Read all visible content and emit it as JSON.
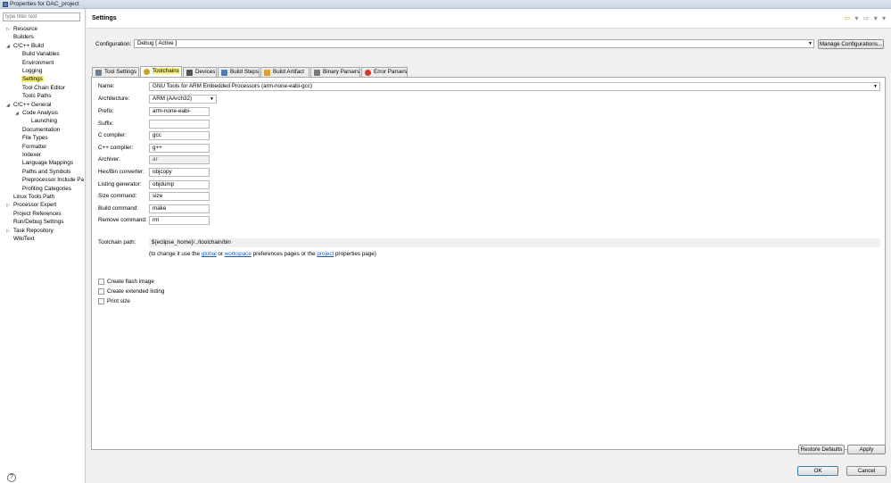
{
  "window": {
    "title": "Properties for DAC_project"
  },
  "left": {
    "filter_placeholder": "type filter text",
    "tree": [
      {
        "label": "Resource",
        "depth": 0,
        "twisty": "▷",
        "selected": false
      },
      {
        "label": "Builders",
        "depth": 0,
        "twisty": "",
        "selected": false
      },
      {
        "label": "C/C++ Build",
        "depth": 0,
        "twisty": "◢",
        "selected": false
      },
      {
        "label": "Build Variables",
        "depth": 1,
        "twisty": "",
        "selected": false
      },
      {
        "label": "Environment",
        "depth": 1,
        "twisty": "",
        "selected": false
      },
      {
        "label": "Logging",
        "depth": 1,
        "twisty": "",
        "selected": false
      },
      {
        "label": "Settings",
        "depth": 1,
        "twisty": "",
        "selected": true
      },
      {
        "label": "Tool Chain Editor",
        "depth": 1,
        "twisty": "",
        "selected": false
      },
      {
        "label": "Tools Paths",
        "depth": 1,
        "twisty": "",
        "selected": false
      },
      {
        "label": "C/C++ General",
        "depth": 0,
        "twisty": "◢",
        "selected": false
      },
      {
        "label": "Code Analysis",
        "depth": 1,
        "twisty": "◢",
        "selected": false
      },
      {
        "label": "Launching",
        "depth": 2,
        "twisty": "",
        "selected": false
      },
      {
        "label": "Documentation",
        "depth": 1,
        "twisty": "",
        "selected": false
      },
      {
        "label": "File Types",
        "depth": 1,
        "twisty": "",
        "selected": false
      },
      {
        "label": "Formatter",
        "depth": 1,
        "twisty": "",
        "selected": false
      },
      {
        "label": "Indexer",
        "depth": 1,
        "twisty": "",
        "selected": false
      },
      {
        "label": "Language Mappings",
        "depth": 1,
        "twisty": "",
        "selected": false
      },
      {
        "label": "Paths and Symbols",
        "depth": 1,
        "twisty": "",
        "selected": false
      },
      {
        "label": "Preprocessor Include Pa",
        "depth": 1,
        "twisty": "",
        "selected": false
      },
      {
        "label": "Profiling Categories",
        "depth": 1,
        "twisty": "",
        "selected": false
      },
      {
        "label": "Linux Tools Path",
        "depth": 0,
        "twisty": "",
        "selected": false
      },
      {
        "label": "Processor Expert",
        "depth": 0,
        "twisty": "▷",
        "selected": false
      },
      {
        "label": "Project References",
        "depth": 0,
        "twisty": "",
        "selected": false
      },
      {
        "label": "Run/Debug Settings",
        "depth": 0,
        "twisty": "",
        "selected": false
      },
      {
        "label": "Task Repository",
        "depth": 0,
        "twisty": "▷",
        "selected": false
      },
      {
        "label": "WikiText",
        "depth": 0,
        "twisty": "",
        "selected": false
      }
    ],
    "help": "?"
  },
  "header": {
    "title": "Settings",
    "nav_back": "⇦",
    "nav_back_menu": "▾",
    "nav_forward": "⇨",
    "nav_forward_menu": "▾",
    "nav_menu": "▾"
  },
  "configuration": {
    "label": "Configuration:",
    "value": "Debug  [ Active ]",
    "manage_label": "Manage Configurations..."
  },
  "tabs": [
    {
      "label": "Tool Settings",
      "icon": "tool-settings-icon",
      "color": "#6a7f95",
      "active": false
    },
    {
      "label": "Toolchains",
      "icon": "toolchain-icon",
      "color": "#c8a31a",
      "active": true
    },
    {
      "label": "Devices",
      "icon": "device-icon",
      "color": "#555555",
      "active": false
    },
    {
      "label": "Build Steps",
      "icon": "build-steps-icon",
      "color": "#4f7fb5",
      "active": false
    },
    {
      "label": "Build Artifact",
      "icon": "build-artifact-icon",
      "color": "#e0a030",
      "active": false
    },
    {
      "label": "Binary Parsers",
      "icon": "binary-parser-icon",
      "color": "#7a7a7a",
      "active": false
    },
    {
      "label": "Error Parsers",
      "icon": "error-parser-icon",
      "color": "#d2372b",
      "active": false
    }
  ],
  "toolchain": {
    "name_label": "Name:",
    "name_value": "GNU Tools for ARM Embedded Processors (arm-none-eabi-gcc)",
    "arch_label": "Architecture:",
    "arch_value": "ARM (AArch32)",
    "fields": [
      {
        "label": "Prefix:",
        "value": "arm-none-eabi-",
        "readonly": false
      },
      {
        "label": "Suffix:",
        "value": "",
        "readonly": false
      },
      {
        "label": "C compiler:",
        "value": "gcc",
        "readonly": false
      },
      {
        "label": "C++ compiler:",
        "value": "g++",
        "readonly": false
      },
      {
        "label": "Archiver:",
        "value": "ar",
        "readonly": true
      },
      {
        "label": "Hex/Bin converter:",
        "value": "objcopy",
        "readonly": false
      },
      {
        "label": "Listing generator:",
        "value": "objdump",
        "readonly": false
      },
      {
        "label": "Size command:",
        "value": "size",
        "readonly": false
      },
      {
        "label": "Build command:",
        "value": "make",
        "readonly": false
      },
      {
        "label": "Remove command:",
        "value": "rm",
        "readonly": false
      }
    ],
    "path_label": "Toolchain path:",
    "path_value": "${eclipse_home}/../toolchain/bin",
    "note_prefix": "(to change it use the ",
    "note_global": "global",
    "note_or": " or ",
    "note_workspace": "workspace",
    "note_mid": " preferences pages or the ",
    "note_project": "project",
    "note_suffix": " properties page)",
    "checkboxes": [
      {
        "label": "Create flash image",
        "checked": false
      },
      {
        "label": "Create extended listing",
        "checked": false
      },
      {
        "label": "Print size",
        "checked": false
      }
    ]
  },
  "buttons": {
    "restore": "Restore Defaults",
    "apply": "Apply",
    "ok": "OK",
    "cancel": "Cancel"
  }
}
